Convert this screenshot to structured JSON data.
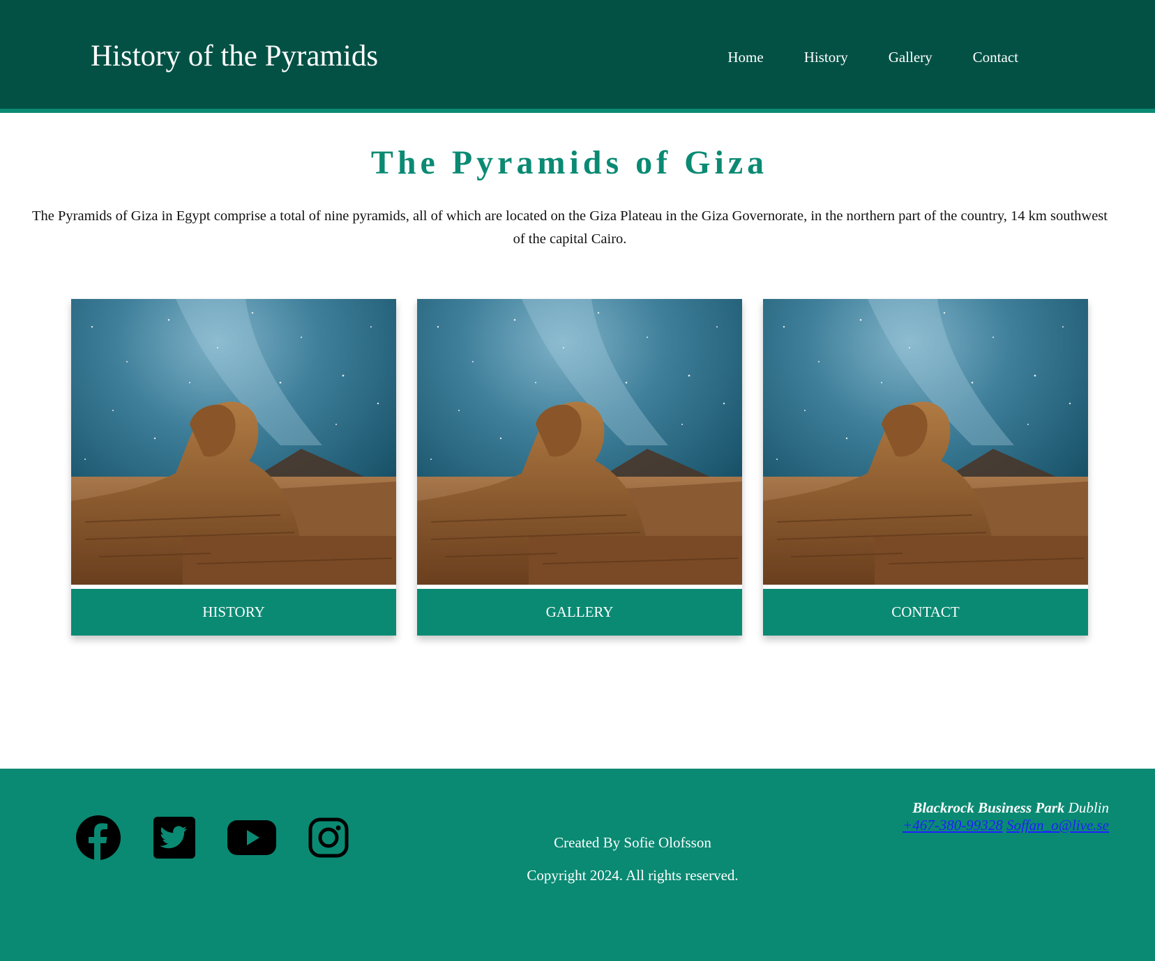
{
  "header": {
    "title": "History of the Pyramids",
    "nav": [
      {
        "label": "Home"
      },
      {
        "label": "History"
      },
      {
        "label": "Gallery"
      },
      {
        "label": "Contact"
      }
    ]
  },
  "main": {
    "title": "The Pyramids of Giza",
    "intro": "The Pyramids of Giza in Egypt comprise a total of nine pyramids, all of which are located on the Giza Plateau in the Giza Governorate, in the northern part of the country, 14 km southwest of the capital Cairo.",
    "cards": [
      {
        "label": "HISTORY",
        "image": "sphinx-night-sky-image"
      },
      {
        "label": "GALLERY",
        "image": "sphinx-night-sky-image"
      },
      {
        "label": "CONTACT",
        "image": "sphinx-night-sky-image"
      }
    ]
  },
  "footer": {
    "social_icons": [
      "facebook-icon",
      "twitter-icon",
      "youtube-icon",
      "instagram-icon"
    ],
    "created_by": "Created By Sofie Olofsson",
    "copyright": "Copyright 2024. All rights reserved.",
    "address_bold": "Blackrock Business Park",
    "address_city": "Dublin",
    "phone": "+467-380-99328",
    "email": "Soffan_o@live.se"
  },
  "colors": {
    "header_bg": "#035145",
    "accent": "#0a8a73",
    "link": "#1f1fff"
  }
}
